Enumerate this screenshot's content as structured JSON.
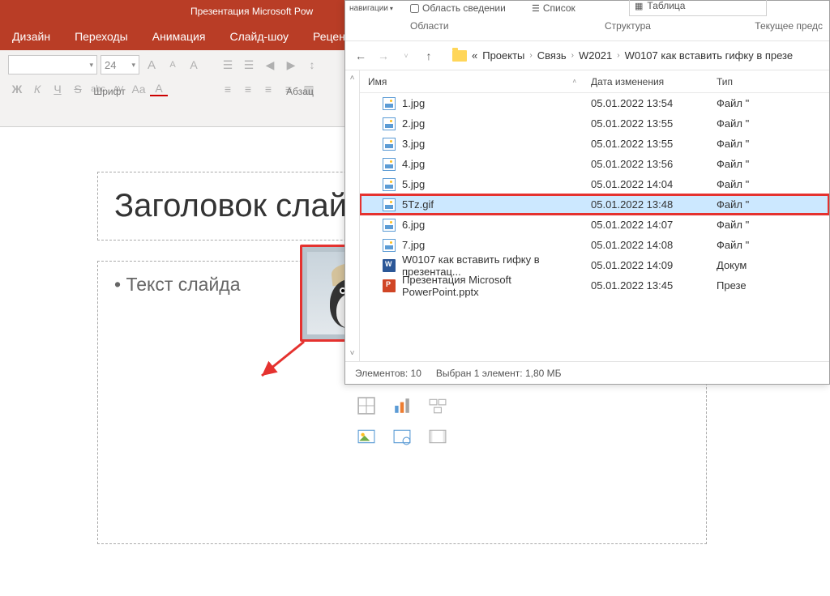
{
  "powerpoint": {
    "title": "Презентация Microsoft Pow",
    "tabs": [
      "Дизайн",
      "Переходы",
      "Анимация",
      "Слайд-шоу",
      "Рецензи"
    ],
    "font": {
      "size": "24",
      "group_label": "Шрифт",
      "bold": "Ж",
      "italic": "К",
      "underline": "Ч",
      "strike": "S",
      "abc": "abc",
      "av": "AV",
      "aa": "Aa",
      "a": "A",
      "inc": "A",
      "dec": "A",
      "clear": "A"
    },
    "paragraph": {
      "group_label": "Абзац"
    },
    "slide_title": "Заголовок слайда",
    "slide_text": "• Текст слайда"
  },
  "explorer": {
    "top_nav_label": "навигации",
    "top_sved": "Область сведении",
    "top_list": "Список",
    "top_table": "Таблица",
    "areas_label": "Области",
    "structure_label": "Структура",
    "current_label": "Текущее предс",
    "breadcrumb": [
      "«",
      "Проекты",
      "Связь",
      "W2021",
      "W0107 как вставить гифку в презе"
    ],
    "headers": {
      "name": "Имя",
      "date": "Дата изменения",
      "type": "Тип"
    },
    "files": [
      {
        "name": "1.jpg",
        "date": "05.01.2022 13:54",
        "type": "Файл \"",
        "icon": "img",
        "selected": false
      },
      {
        "name": "2.jpg",
        "date": "05.01.2022 13:55",
        "type": "Файл \"",
        "icon": "img",
        "selected": false
      },
      {
        "name": "3.jpg",
        "date": "05.01.2022 13:55",
        "type": "Файл \"",
        "icon": "img",
        "selected": false
      },
      {
        "name": "4.jpg",
        "date": "05.01.2022 13:56",
        "type": "Файл \"",
        "icon": "img",
        "selected": false
      },
      {
        "name": "5.jpg",
        "date": "05.01.2022 14:04",
        "type": "Файл \"",
        "icon": "img",
        "selected": false
      },
      {
        "name": "5Tz.gif",
        "date": "05.01.2022 13:48",
        "type": "Файл \"",
        "icon": "img",
        "selected": true
      },
      {
        "name": "6.jpg",
        "date": "05.01.2022 14:07",
        "type": "Файл \"",
        "icon": "img",
        "selected": false
      },
      {
        "name": "7.jpg",
        "date": "05.01.2022 14:08",
        "type": "Файл \"",
        "icon": "img",
        "selected": false
      },
      {
        "name": "W0107 как вставить гифку в презентац...",
        "date": "05.01.2022 14:09",
        "type": "Докум",
        "icon": "doc",
        "selected": false
      },
      {
        "name": "Презентация Microsoft PowerPoint.pptx",
        "date": "05.01.2022 13:45",
        "type": "Презе",
        "icon": "ppt",
        "selected": false
      }
    ],
    "status_count": "Элементов: 10",
    "status_selected": "Выбран 1 элемент: 1,80 МБ"
  }
}
